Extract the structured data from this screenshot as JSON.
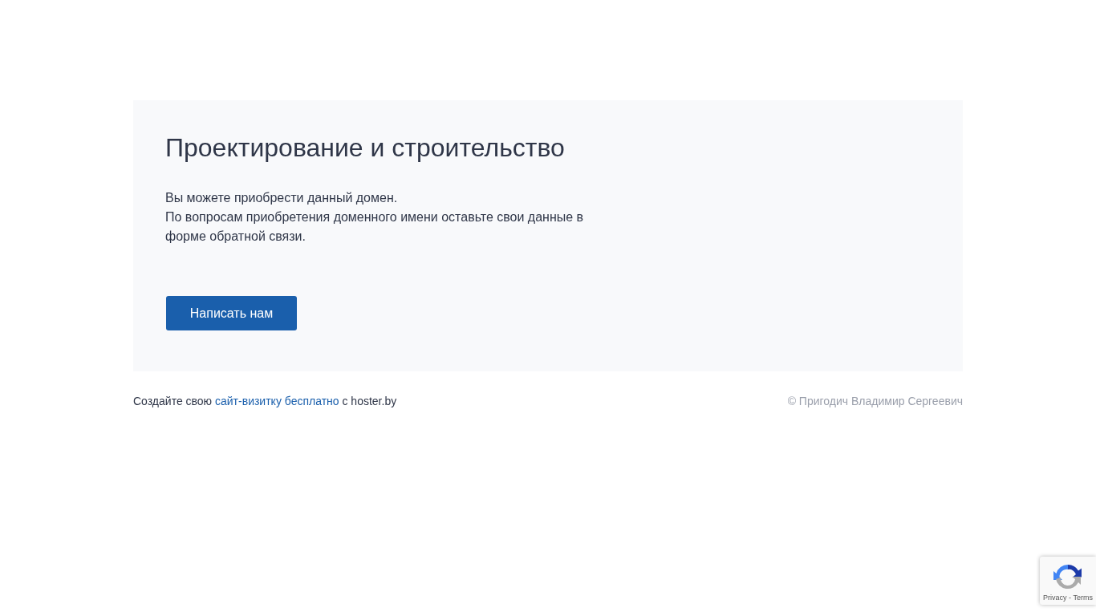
{
  "card": {
    "title": "Проектирование и строительство",
    "lines": [
      "Вы можете приобрести данный домен.",
      "По вопросам приобретения доменного имени оставьте свои данные в форме обратной связи."
    ],
    "button": "Написать нам"
  },
  "footer": {
    "before": "Создайте свою",
    "link": "сайт-визитку бесплатно",
    "after": "с hoster.by",
    "copyright": "© Пригодич Владимир Сергеевич"
  },
  "recaptcha": {
    "privacy": "Privacy",
    "separator": "-",
    "terms": "Terms"
  }
}
